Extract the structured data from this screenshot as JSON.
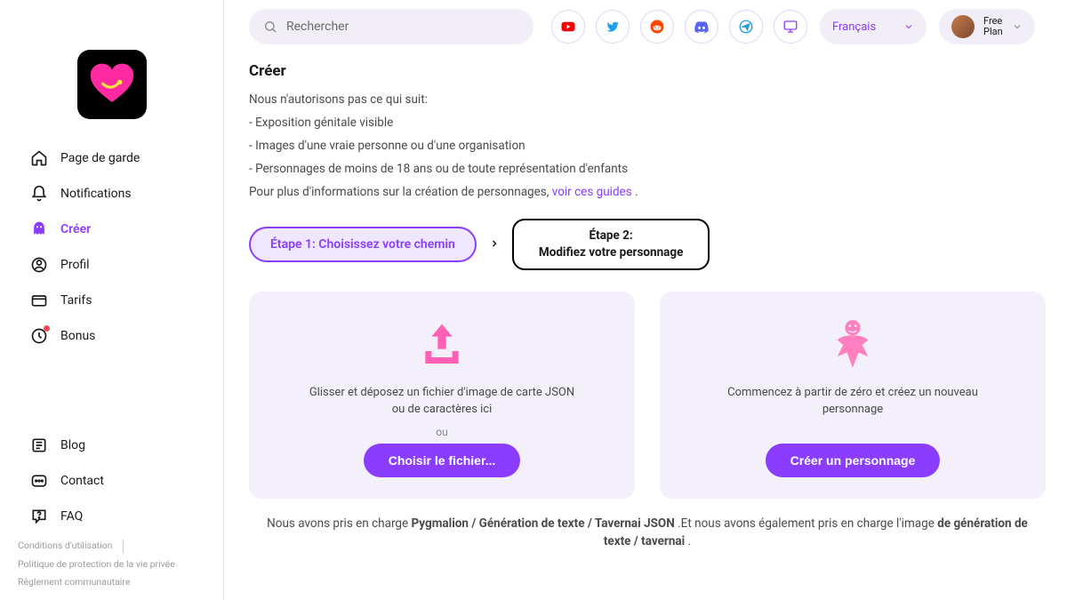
{
  "header": {
    "search_placeholder": "Rechercher",
    "language": "Français",
    "plan_line1": "Free",
    "plan_line2": "Plan"
  },
  "sidebar": {
    "items": [
      {
        "label": "Page de garde"
      },
      {
        "label": "Notifications"
      },
      {
        "label": "Créer"
      },
      {
        "label": "Profil"
      },
      {
        "label": "Tarifs"
      },
      {
        "label": "Bonus"
      }
    ],
    "bottom": [
      {
        "label": "Blog"
      },
      {
        "label": "Contact"
      },
      {
        "label": "FAQ"
      }
    ],
    "footer": {
      "terms": "Conditions d'utilisation",
      "privacy": "Politique de protection de la vie privée",
      "community": "Règlement communautaire"
    }
  },
  "content": {
    "title": "Créer",
    "intro": "Nous n'autorisons pas ce qui suit:",
    "rule1": "- Exposition génitale visible",
    "rule2": "- Images d'une vraie personne ou d'une organisation",
    "rule3": "- Personnages de moins de 18 ans ou de toute représentation d'enfants",
    "guide_prefix": "Pour plus d'informations sur la création de personnages, ",
    "guide_link": "voir ces guides",
    "guide_suffix": " .",
    "step1": "Étape 1:  Choisissez votre chemin",
    "step2_line1": "Étape 2:",
    "step2_line2": "Modifiez votre personnage",
    "card_upload_text": "Glisser et déposez un fichier d'image de carte JSON ou de caractères ici",
    "card_upload_or": "ou",
    "card_upload_btn": "Choisir le fichier...",
    "card_create_text": "Commencez à partir de zéro et créez un nouveau personnage",
    "card_create_btn": "Créer un personnage",
    "support_1": "Nous avons pris en charge ",
    "support_2": "Pygmalion / Génération de texte / Tavernai JSON",
    "support_3": " .Et nous avons également pris en charge l'image ",
    "support_4": "de génération de texte / tavernai",
    "support_5": " ."
  }
}
